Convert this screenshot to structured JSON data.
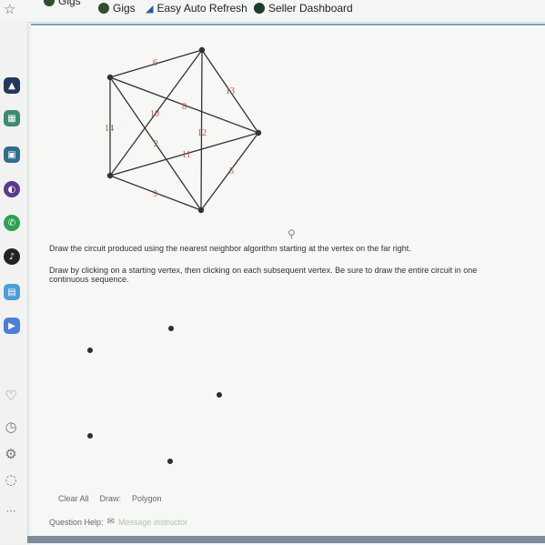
{
  "bookmarks": {
    "items": [
      {
        "label": "Gigs",
        "icon": "gigs-icon"
      },
      {
        "label": "Gigs",
        "icon": "gigs-icon"
      },
      {
        "label": "Easy Auto Refresh",
        "icon": "refresh-icon"
      },
      {
        "label": "Seller Dashboard",
        "icon": "fiverr-icon"
      }
    ]
  },
  "graph": {
    "weights": [
      "6",
      "13",
      "10",
      "8",
      "14",
      "12",
      "2",
      "11",
      "5",
      "9"
    ]
  },
  "question": {
    "prompt": "Draw the circuit produced using the nearest neighbor algorithm starting at the vertex on the far right.",
    "instructions": "Draw by clicking on a starting vertex, then clicking on each subsequent vertex. Be sure to draw the entire circuit in one continuous sequence."
  },
  "controls": {
    "clear_all": "Clear All",
    "draw_label": "Draw:",
    "polygon": "Polygon"
  },
  "help": {
    "label": "Question Help:",
    "message_instructor": "Message instructor"
  },
  "colors": {
    "accent": "#7aa2c4",
    "weight_label": "#b05555"
  }
}
